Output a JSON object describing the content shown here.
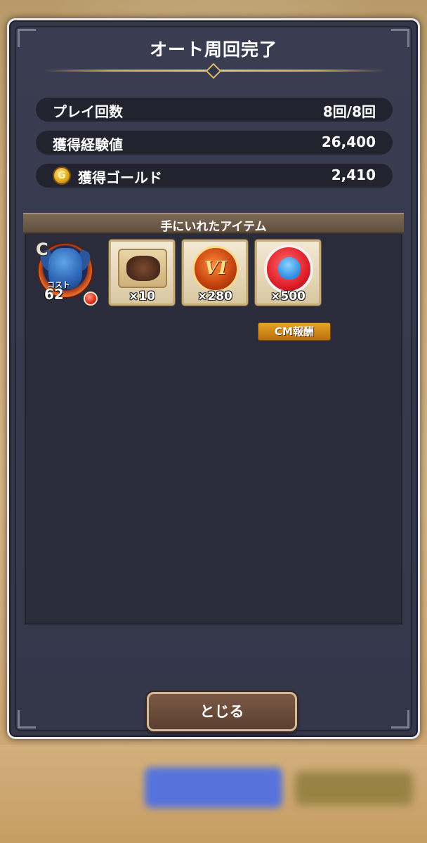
{
  "dialog": {
    "title": "オート周回完了"
  },
  "stats": [
    {
      "label": "プレイ回数",
      "value": "8回/8回"
    },
    {
      "label": "獲得経験値",
      "value": "26,400"
    },
    {
      "label": "獲得ゴールド",
      "value": "2,410",
      "icon": "gold-coin-icon",
      "icon_glyph": "G"
    }
  ],
  "items_section": {
    "header": "手にいれたアイテム",
    "monster": {
      "rank": "C",
      "cost_label": "コスト",
      "cost_value": "62",
      "icon": "monster-icon"
    },
    "items": [
      {
        "name": "scroll-icon",
        "count": "×10"
      },
      {
        "name": "medal-vi-icon",
        "count": "×280",
        "glyph": "VI"
      },
      {
        "name": "slime-coin-icon",
        "count": "×500",
        "ribbon": "CM報酬"
      }
    ]
  },
  "buttons": {
    "close_label": "とじる"
  },
  "colors": {
    "dialog_bg": "#34364a",
    "row_bg": "#22232f",
    "accent_gold": "#c9a55a",
    "button_brown": "#6a4a3a"
  }
}
